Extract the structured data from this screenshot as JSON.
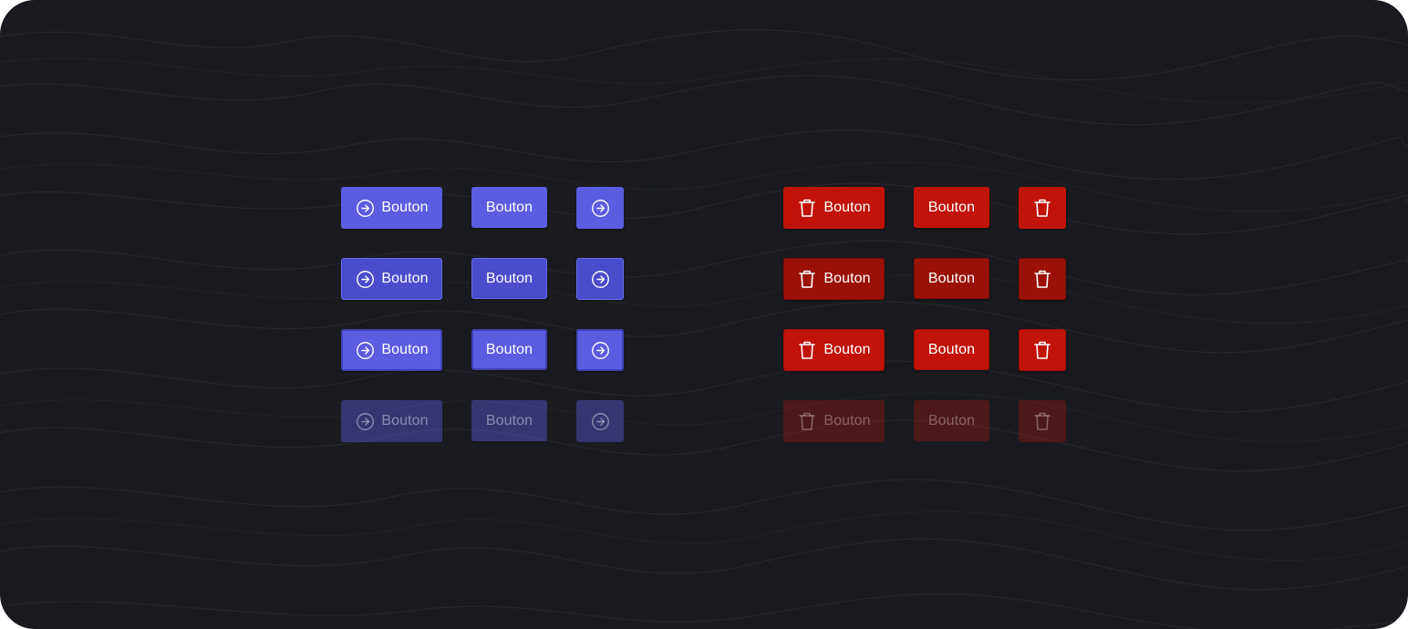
{
  "theme": {
    "background": "#1a1b20",
    "primary": "#5b5ce0",
    "primary_hover": "#4b4ccb",
    "danger": "#c11308",
    "danger_hover": "#9a1108"
  },
  "primary_group": {
    "icon": "arrow-right-circle-icon",
    "rows": [
      {
        "state": "default",
        "with_icon_label": "Bouton",
        "text_only_label": "Bouton"
      },
      {
        "state": "hover",
        "with_icon_label": "Bouton",
        "text_only_label": "Bouton"
      },
      {
        "state": "focus",
        "with_icon_label": "Bouton",
        "text_only_label": "Bouton"
      },
      {
        "state": "disabled",
        "with_icon_label": "Bouton",
        "text_only_label": "Bouton"
      }
    ]
  },
  "danger_group": {
    "icon": "trash-icon",
    "rows": [
      {
        "state": "default",
        "with_icon_label": "Bouton",
        "text_only_label": "Bouton"
      },
      {
        "state": "hover",
        "with_icon_label": "Bouton",
        "text_only_label": "Bouton"
      },
      {
        "state": "focus",
        "with_icon_label": "Bouton",
        "text_only_label": "Bouton"
      },
      {
        "state": "disabled",
        "with_icon_label": "Bouton",
        "text_only_label": "Bouton"
      }
    ]
  }
}
